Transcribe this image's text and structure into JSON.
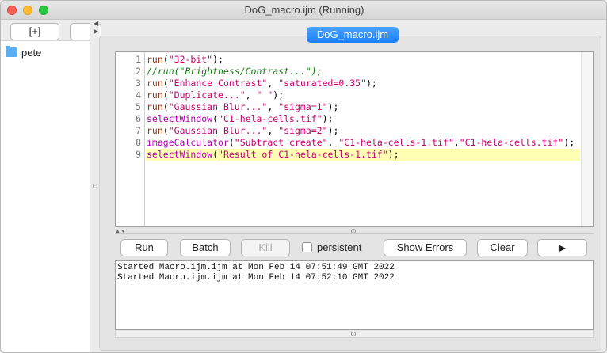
{
  "window": {
    "title": "DoG_macro.ijm (Running)"
  },
  "sidebar": {
    "add_button": "[+]",
    "second_button": "",
    "tree": [
      {
        "label": "pete",
        "icon": "folder-icon"
      }
    ]
  },
  "tabs": [
    {
      "label": "DoG_macro.ijm",
      "active": true
    }
  ],
  "editor": {
    "highlight_line": 9,
    "lines": [
      {
        "no": "1",
        "text": "run(\"32-bit\");"
      },
      {
        "no": "2",
        "text": "//run(\"Brightness/Contrast...\");"
      },
      {
        "no": "3",
        "text": "run(\"Enhance Contrast\", \"saturated=0.35\");"
      },
      {
        "no": "4",
        "text": "run(\"Duplicate...\", \" \");"
      },
      {
        "no": "5",
        "text": "run(\"Gaussian Blur...\", \"sigma=1\");"
      },
      {
        "no": "6",
        "text": "selectWindow(\"C1-hela-cells.tif\");"
      },
      {
        "no": "7",
        "text": "run(\"Gaussian Blur...\", \"sigma=2\");"
      },
      {
        "no": "8",
        "text": "imageCalculator(\"Subtract create\", \"C1-hela-cells-1.tif\",\"C1-hela-cells.tif\");"
      },
      {
        "no": "9",
        "text": "selectWindow(\"Result of C1-hela-cells-1.tif\");"
      }
    ]
  },
  "toolbar": {
    "run": "Run",
    "batch": "Batch",
    "kill": "Kill",
    "persistent": "persistent",
    "show_errors": "Show Errors",
    "clear": "Clear",
    "play": "▶"
  },
  "console": {
    "lines": [
      "Started Macro.ijm.ijm at Mon Feb 14 07:51:49 GMT 2022",
      "Started Macro.ijm.ijm at Mon Feb 14 07:52:10 GMT 2022"
    ]
  },
  "colors": {
    "tab_accent": "#1a7ef5",
    "highlight_line": "#ffffb3",
    "folder": "#5aaef2"
  }
}
